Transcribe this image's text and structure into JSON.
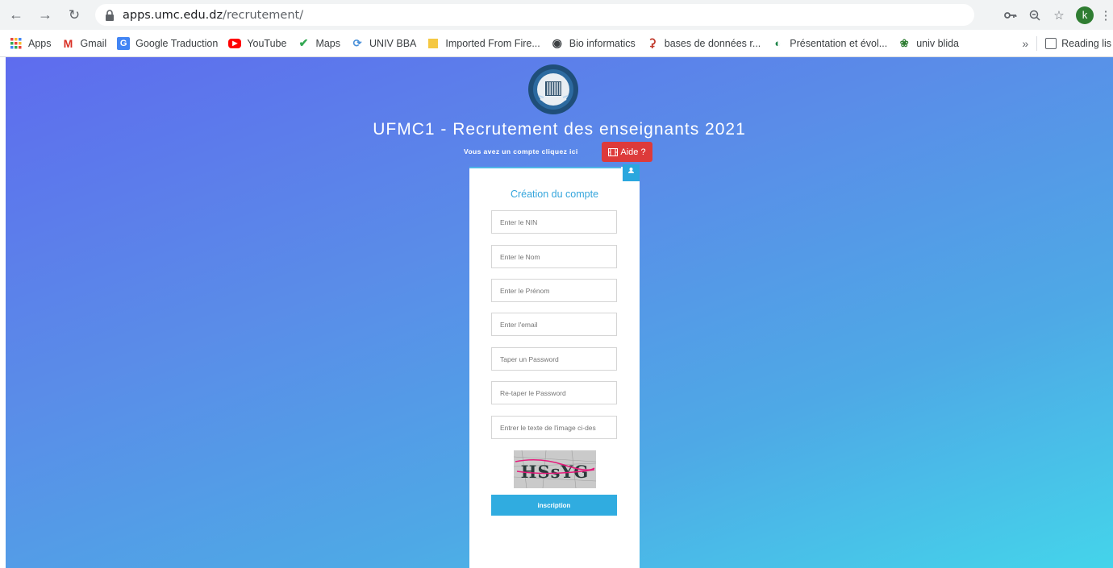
{
  "browser": {
    "url_host": "apps.umc.edu.dz",
    "url_path": "/recrutement/",
    "avatar_letter": "k"
  },
  "bookmarks": [
    {
      "label": "Apps",
      "icon": "apps-grid-icon"
    },
    {
      "label": "Gmail",
      "icon": "gmail-icon"
    },
    {
      "label": "Google Traduction",
      "icon": "google-translate-icon"
    },
    {
      "label": "YouTube",
      "icon": "youtube-icon"
    },
    {
      "label": "Maps",
      "icon": "maps-icon"
    },
    {
      "label": "UNIV BBA",
      "icon": "univ-bba-icon"
    },
    {
      "label": "Imported From Fire...",
      "icon": "folder-icon"
    },
    {
      "label": "Bio informatics",
      "icon": "globe-icon"
    },
    {
      "label": "bases de données r...",
      "icon": "site-icon"
    },
    {
      "label": "Présentation et évol...",
      "icon": "site-icon"
    },
    {
      "label": "univ blida",
      "icon": "univ-blida-icon"
    }
  ],
  "bookmarks_overflow": "»",
  "reading_list": "Reading lis",
  "page": {
    "title": "UFMC1 - Recrutement des enseignants 2021",
    "account_link": "Vous avez un compte cliquez ici",
    "aide_label": "Aide ?",
    "form_title": "Création du compte",
    "fields": {
      "nin": "Enter le NIN",
      "nom": "Enter le Nom",
      "prenom": "Enter le Prénom",
      "email": "Enter l'email",
      "password": "Taper un Password",
      "password_confirm": "Re-taper le Password",
      "captcha_input": "Entrer le texte de l'image ci-des"
    },
    "captcha_text": "HSsYG",
    "submit_label": "inscription"
  },
  "colors": {
    "gradient_start": "#5e6cee",
    "gradient_end": "#44d4ea",
    "accent": "#30ace0",
    "aide_red": "#dd3a3a"
  }
}
